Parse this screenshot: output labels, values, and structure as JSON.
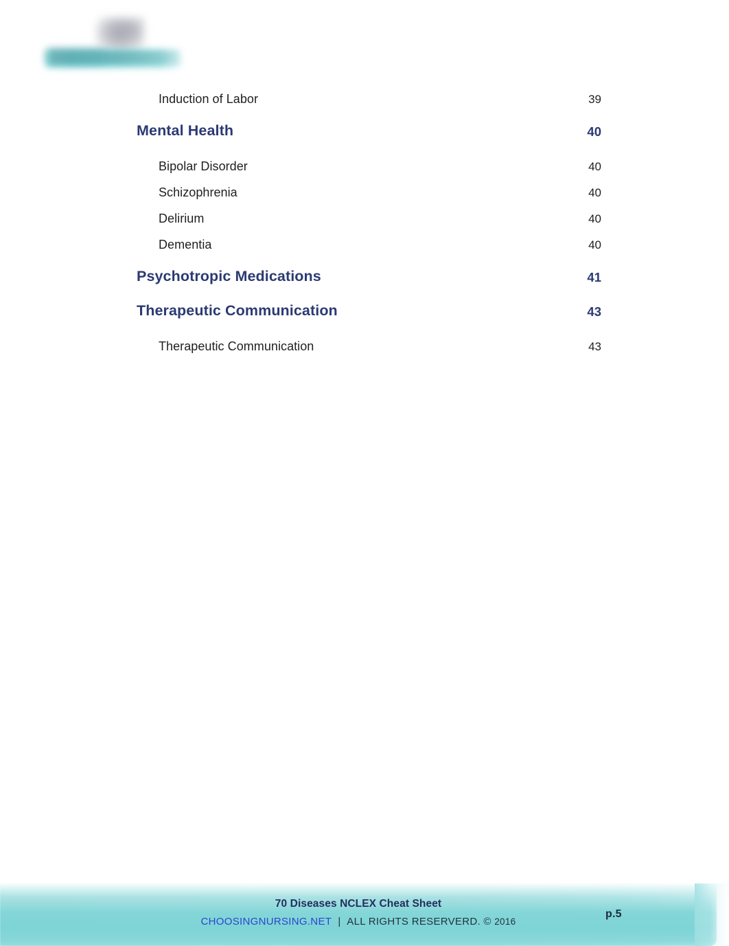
{
  "document": {
    "background_color": "#ffffff",
    "accent_navy": "#2B3A72",
    "accent_teal": "#7FD2D4",
    "link_color": "#2B44D0"
  },
  "logo": {
    "name": "choosingnursing-logo",
    "alt": "ChoosingNursing logo"
  },
  "toc": {
    "rows": [
      {
        "level": "sub",
        "label": "Induction of Labor",
        "page": "39"
      },
      {
        "level": "section",
        "label": "Mental Health",
        "page": "40"
      },
      {
        "level": "sub",
        "label": "Bipolar Disorder",
        "page": "40"
      },
      {
        "level": "sub",
        "label": "Schizophrenia",
        "page": "40"
      },
      {
        "level": "sub",
        "label": "Delirium",
        "page": "40"
      },
      {
        "level": "sub",
        "label": "Dementia",
        "page": "40"
      },
      {
        "level": "section",
        "label": "Psychotropic Medications",
        "page": "41"
      },
      {
        "level": "section",
        "label": "Therapeutic Communication",
        "page": "43"
      },
      {
        "level": "sub",
        "label": "Therapeutic Communication",
        "page": "43"
      }
    ]
  },
  "footer": {
    "title": "70 Diseases NCLEX Cheat Sheet",
    "site": "CHOOSINGNURSING.NET",
    "separator": "|",
    "rights": "ALL RIGHTS RESERVERD. ©",
    "year": "2016",
    "page_label": "p.5"
  }
}
